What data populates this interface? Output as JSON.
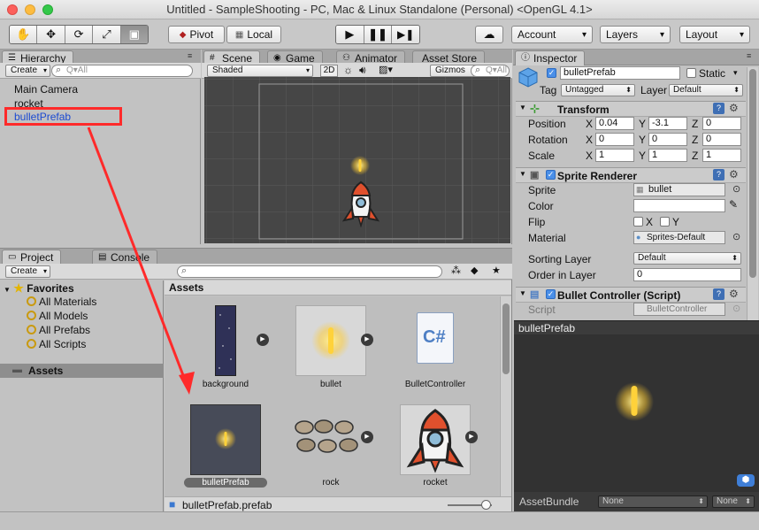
{
  "window": {
    "title": "Untitled - SampleShooting - PC, Mac & Linux Standalone (Personal) <OpenGL 4.1>"
  },
  "toolbar": {
    "tools": [
      "hand-icon",
      "move-icon",
      "rotate-icon",
      "scale-icon",
      "rect-icon"
    ],
    "pivot_label": "Pivot",
    "local_label": "Local",
    "account_label": "Account",
    "layers_label": "Layers",
    "layout_label": "Layout"
  },
  "hierarchy": {
    "tab_label": "Hierarchy",
    "create_label": "Create",
    "search_placeholder": "Q▾All",
    "items": [
      "Main Camera",
      "rocket",
      "bulletPrefab"
    ]
  },
  "scene": {
    "tabs": [
      "Scene",
      "Game",
      "Animator",
      "Asset Store"
    ],
    "shading_label": "Shaded",
    "mode_2d": "2D",
    "gizmos_label": "Gizmos",
    "search_placeholder": "Q▾All"
  },
  "project": {
    "tabs": [
      "Project",
      "Console"
    ],
    "create_label": "Create",
    "favorites_label": "Favorites",
    "favorites": [
      "All Materials",
      "All Models",
      "All Prefabs",
      "All Scripts"
    ],
    "assets_root": "Assets",
    "breadcrumb": "Assets",
    "assets": [
      {
        "name": "background",
        "kind": "texture"
      },
      {
        "name": "bullet",
        "kind": "sprite"
      },
      {
        "name": "BulletController",
        "kind": "script"
      },
      {
        "name": "bulletPrefab",
        "kind": "prefab"
      },
      {
        "name": "rock",
        "kind": "sprite"
      },
      {
        "name": "rocket",
        "kind": "sprite"
      }
    ],
    "selected_file": "bulletPrefab.prefab",
    "script_glyph": "C#"
  },
  "inspector": {
    "tab_label": "Inspector",
    "object_name": "bulletPrefab",
    "static_label": "Static",
    "tag_label": "Tag",
    "tag_value": "Untagged",
    "layer_label": "Layer",
    "layer_value": "Default",
    "transform": {
      "title": "Transform",
      "position_label": "Position",
      "rotation_label": "Rotation",
      "scale_label": "Scale",
      "position": {
        "x": "0.04",
        "y": "-3.1",
        "z": "0"
      },
      "rotation": {
        "x": "0",
        "y": "0",
        "z": "0"
      },
      "scale": {
        "x": "1",
        "y": "1",
        "z": "1"
      }
    },
    "sprite_renderer": {
      "title": "Sprite Renderer",
      "sprite_label": "Sprite",
      "sprite_value": "bullet",
      "color_label": "Color",
      "flip_label": "Flip",
      "flip_x": "X",
      "flip_y": "Y",
      "material_label": "Material",
      "material_value": "Sprites-Default",
      "sorting_layer_label": "Sorting Layer",
      "sorting_layer_value": "Default",
      "order_label": "Order in Layer",
      "order_value": "0"
    },
    "bullet_controller": {
      "title": "Bullet Controller (Script)",
      "script_label": "Script",
      "script_value": "BulletController"
    },
    "preview_title": "bulletPrefab",
    "assetbundle_label": "AssetBundle",
    "assetbundle_value": "None",
    "assetbundle_variant": "None"
  },
  "axis_labels": {
    "x": "X",
    "y": "Y",
    "z": "Z"
  },
  "colors": {
    "accent_selected": "#3a72d8",
    "annotation_red": "#ff2a2a",
    "bullet_glow": "#ffd23a"
  }
}
